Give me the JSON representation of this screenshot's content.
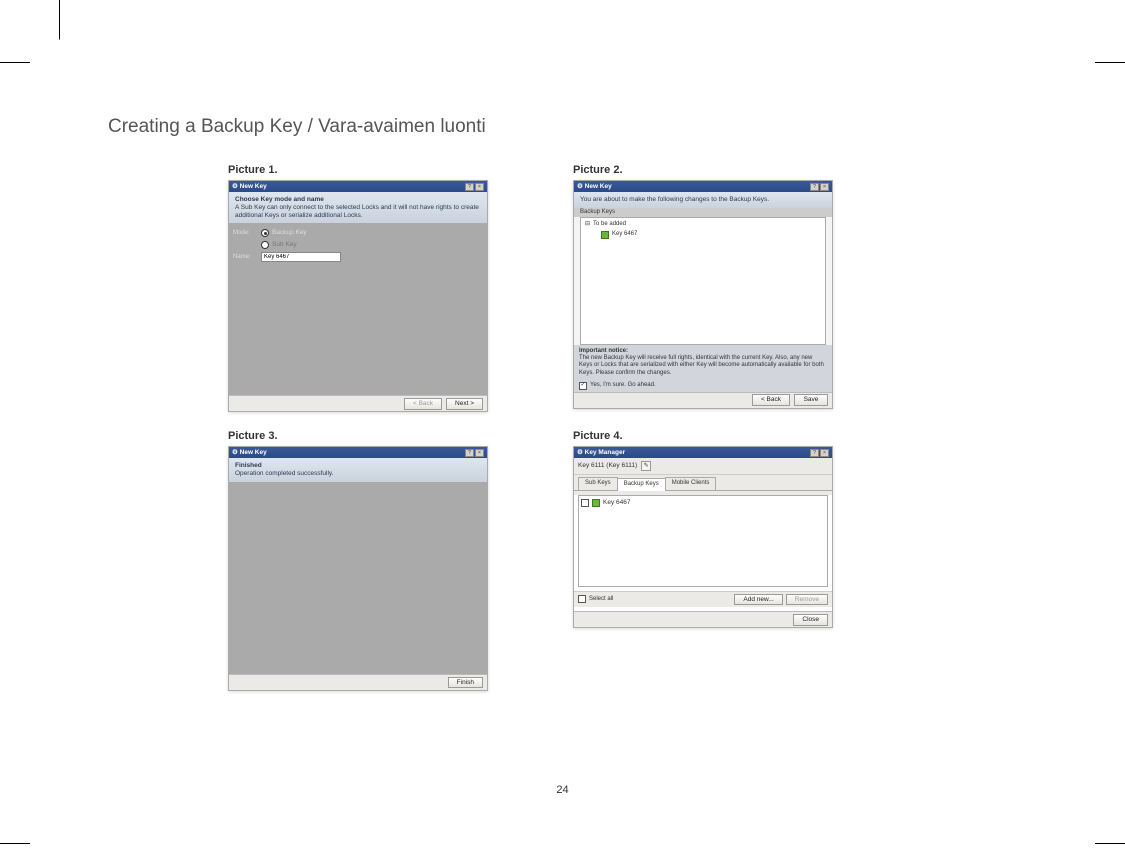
{
  "page_title": "Creating a Backup Key / Vara-avaimen luonti",
  "page_number": "24",
  "captions": {
    "p1": "Picture 1.",
    "p2": "Picture 2.",
    "p3": "Picture 3.",
    "p4": "Picture 4."
  },
  "pic1": {
    "window_title": "New Key",
    "banner_bold": "Choose Key mode and name",
    "banner_text": "A Sub Key can only connect to the selected Locks and it will not have rights to create additional Keys or serialize additional Locks.",
    "mode_label": "Mode:",
    "radio_backup": "Backup Key",
    "radio_sub": "Sub Key",
    "name_label": "Name:",
    "name_value": "Key 6467",
    "back_btn": "< Back",
    "next_btn": "Next >"
  },
  "pic2": {
    "window_title": "New Key",
    "banner_text": "You are about to make the following changes to the Backup Keys.",
    "group_label": "Backup Keys",
    "tree_label": "To be added",
    "tree_item": "Key 6467",
    "notice_bold": "Important notice:",
    "notice_text": "The new Backup Key will receive full rights, identical with the current Key. Also, any new Keys or Locks that are serialized with either Key will become automatically available for both Keys. Please confirm the changes.",
    "confirm_label": "Yes, I'm sure. Go ahead.",
    "back_btn": "< Back",
    "save_btn": "Save"
  },
  "pic3": {
    "window_title": "New Key",
    "banner_bold": "Finished",
    "banner_text": "Operation completed successfully.",
    "finish_btn": "Finish"
  },
  "pic4": {
    "window_title": "Key Manager",
    "breadcrumb": "Key 6111 (Key 6111)",
    "tab_sub": "Sub Keys",
    "tab_backup": "Backup Keys",
    "tab_mobile": "Mobile Clients",
    "list_item": "Key 6467",
    "select_all": "Select all",
    "add_btn": "Add new...",
    "remove_btn": "Remove",
    "close_btn": "Close"
  }
}
